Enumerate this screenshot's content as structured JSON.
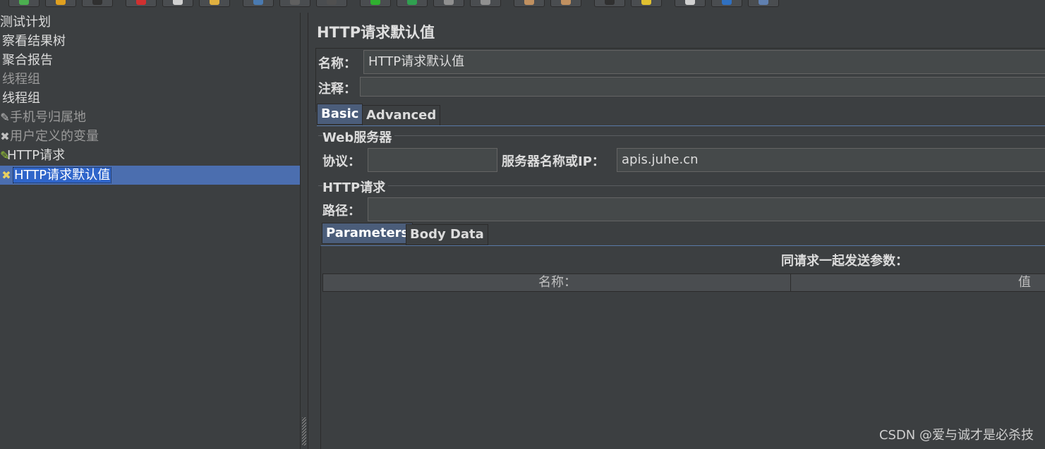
{
  "toolbar": {
    "buttons": [
      {
        "icon": "new-plan-icon",
        "color": "#4caf50"
      },
      {
        "icon": "open-icon",
        "color": "#e0a020"
      },
      {
        "icon": "save-icon",
        "color": "#303030"
      },
      {
        "icon": "cut-icon",
        "color": "#d03030"
      },
      {
        "icon": "copy-icon",
        "color": "#d0d0d0"
      },
      {
        "icon": "paste-icon",
        "color": "#e0b040"
      },
      {
        "icon": "expand-icon",
        "color": "#4a7ab0"
      },
      {
        "icon": "collapse-icon",
        "color": "#606060"
      },
      {
        "icon": "toggle-icon",
        "color": "#505050"
      },
      {
        "icon": "start-icon",
        "color": "#30b030"
      },
      {
        "icon": "start-no-pause-icon",
        "color": "#30a050"
      },
      {
        "icon": "stop-icon",
        "color": "#909090"
      },
      {
        "icon": "shutdown-icon",
        "color": "#909090"
      },
      {
        "icon": "clear-icon",
        "color": "#c09060"
      },
      {
        "icon": "clear-all-icon",
        "color": "#c09060"
      },
      {
        "icon": "search-icon",
        "color": "#303030"
      },
      {
        "icon": "reset-search-icon",
        "color": "#e0c030"
      },
      {
        "icon": "function-helper-icon",
        "color": "#d0d0d0"
      },
      {
        "icon": "help-icon",
        "color": "#3070c0"
      },
      {
        "icon": "remote-icon",
        "color": "#6080b0"
      }
    ]
  },
  "tree": {
    "items": [
      {
        "label": "测试计划",
        "icon": "",
        "style": "normal"
      },
      {
        "label": "察看结果树",
        "icon": "",
        "style": "normal"
      },
      {
        "label": "聚合报告",
        "icon": "",
        "style": "normal"
      },
      {
        "label": "线程组",
        "icon": "",
        "style": "dim"
      },
      {
        "label": "线程组",
        "icon": "",
        "style": "normal"
      },
      {
        "label": "手机号归属地",
        "icon": "pencil-icon",
        "style": "dim"
      },
      {
        "label": "用户定义的变量",
        "icon": "wrench-icon",
        "style": "dim"
      },
      {
        "label": "HTTP请求",
        "icon": "pencil-icon",
        "style": "normal"
      },
      {
        "label": "HTTP请求默认值",
        "icon": "wrench-icon",
        "style": "selected"
      }
    ]
  },
  "main": {
    "title": "HTTP请求默认值",
    "name_label": "名称：",
    "name_value": "HTTP请求默认值",
    "comment_label": "注释：",
    "comment_value": "",
    "tabs": [
      {
        "label": "Basic"
      },
      {
        "label": "Advanced"
      }
    ],
    "web_server": {
      "group_title": "Web服务器",
      "protocol_label": "协议：",
      "protocol_value": "",
      "server_label": "服务器名称或IP：",
      "server_value": "apis.juhe.cn"
    },
    "http_request": {
      "group_title": "HTTP请求",
      "path_label": "路径：",
      "path_value": ""
    },
    "sub_tabs": [
      {
        "label": "Parameters"
      },
      {
        "label": "Body Data"
      }
    ],
    "params_caption": "同请求一起发送参数：",
    "table_columns": [
      {
        "label": "名称："
      },
      {
        "label": "值"
      }
    ]
  },
  "watermark": "CSDN @爱与诚才是必杀技"
}
